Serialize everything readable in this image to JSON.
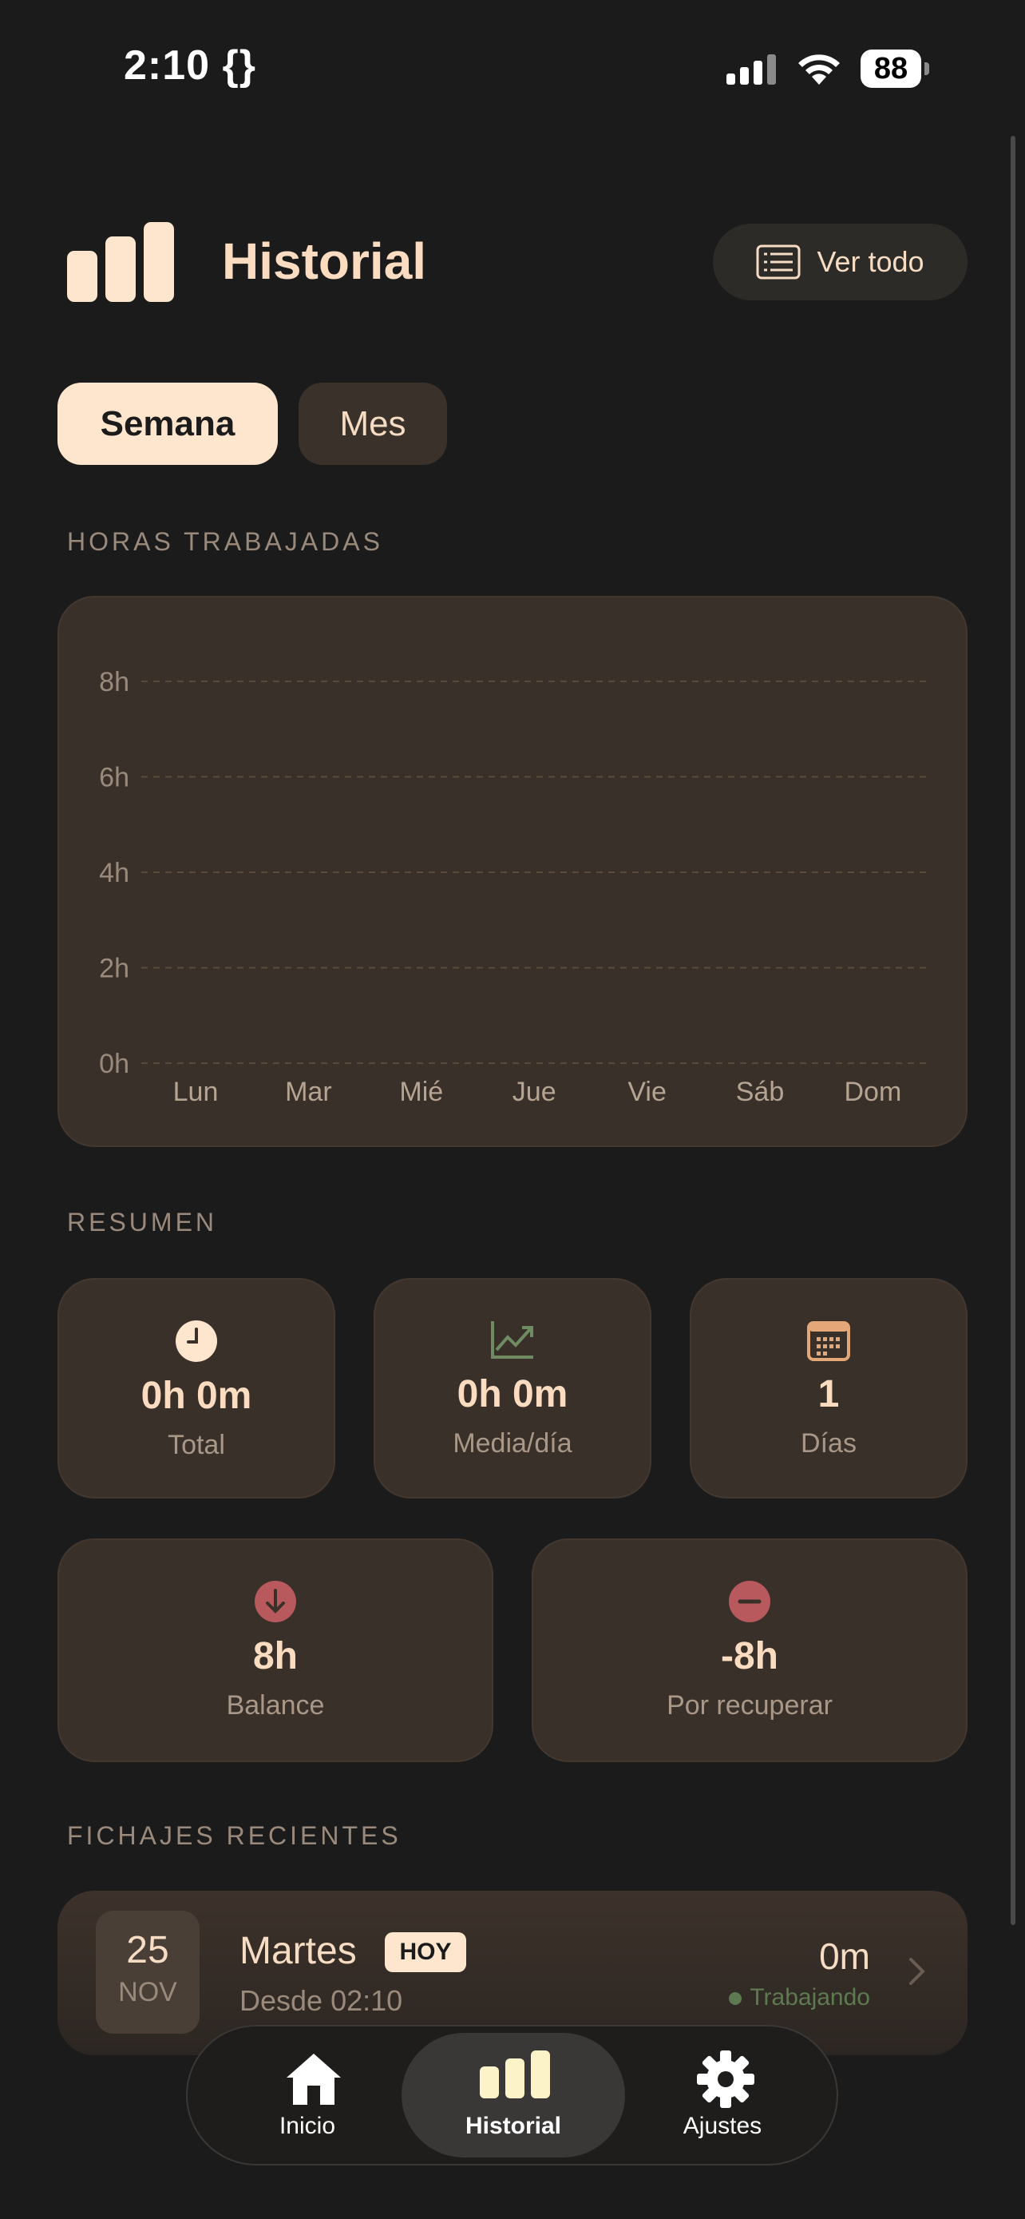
{
  "status_bar": {
    "time": "2:10 {}",
    "battery": "88"
  },
  "header": {
    "title": "Historial",
    "view_all_label": "Ver todo"
  },
  "segments": {
    "week": "Semana",
    "month": "Mes",
    "selected": "Semana"
  },
  "chart_section": {
    "label": "HORAS TRABAJADAS"
  },
  "chart_data": {
    "type": "bar",
    "categories": [
      "Lun",
      "Mar",
      "Mié",
      "Jue",
      "Vie",
      "Sáb",
      "Dom"
    ],
    "values": [
      0,
      0,
      0,
      0,
      0,
      0,
      0
    ],
    "y_ticks": [
      "8h",
      "6h",
      "4h",
      "2h",
      "0h"
    ],
    "ylim": [
      0,
      8
    ],
    "grid": true
  },
  "summary": {
    "label": "RESUMEN",
    "total": {
      "value": "0h 0m",
      "label": "Total",
      "icon": "clock-icon"
    },
    "average": {
      "value": "0h 0m",
      "label": "Media/día",
      "icon": "trend-up-icon"
    },
    "days": {
      "value": "1",
      "label": "Días",
      "icon": "calendar-icon"
    },
    "balance": {
      "value": "8h",
      "label": "Balance",
      "icon": "arrow-down-icon",
      "color": "#b8595d"
    },
    "to_recover": {
      "value": "-8h",
      "label": "Por recuperar",
      "icon": "minus-circle-icon",
      "color": "#b8595d"
    }
  },
  "recent": {
    "label": "FICHAJES RECIENTES",
    "items": [
      {
        "day": "25",
        "month": "NOV",
        "weekday": "Martes",
        "badge": "HOY",
        "since": "Desde 02:10",
        "duration": "0m",
        "status": "Trabajando",
        "status_color": "#5d7a50"
      }
    ]
  },
  "tabbar": {
    "tabs": [
      {
        "label": "Inicio",
        "icon": "home-icon"
      },
      {
        "label": "Historial",
        "icon": "bar-chart-icon",
        "active": true
      },
      {
        "label": "Ajustes",
        "icon": "gear-icon"
      }
    ]
  },
  "colors": {
    "accent": "#fde6cd",
    "background": "#1b1b1b",
    "card": "#3a302a"
  }
}
